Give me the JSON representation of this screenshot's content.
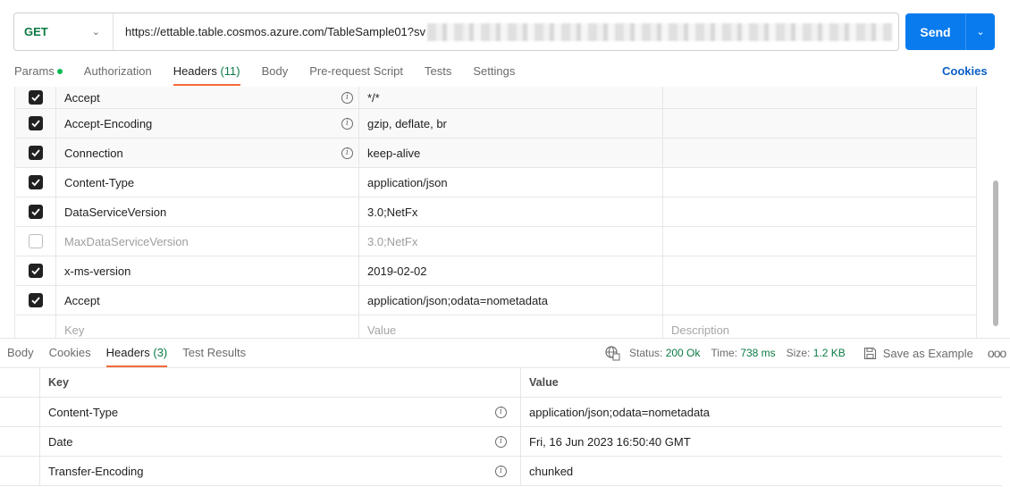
{
  "request": {
    "method": "GET",
    "url": "https://ettable.table.cosmos.azure.com/TableSample01?sv",
    "send_label": "Send"
  },
  "request_tabs": [
    {
      "label": "Params",
      "dot": true
    },
    {
      "label": "Authorization"
    },
    {
      "label": "Headers",
      "count": "(11)",
      "active": true
    },
    {
      "label": "Body"
    },
    {
      "label": "Pre-request Script"
    },
    {
      "label": "Tests"
    },
    {
      "label": "Settings"
    }
  ],
  "cookies_label": "Cookies",
  "request_headers": {
    "rows": [
      {
        "checked": true,
        "key": "Accept",
        "value": "*/*",
        "info": true
      },
      {
        "checked": true,
        "key": "Accept-Encoding",
        "value": "gzip, deflate, br",
        "info": true
      },
      {
        "checked": true,
        "key": "Connection",
        "value": "keep-alive",
        "info": true
      },
      {
        "checked": true,
        "key": "Content-Type",
        "value": "application/json",
        "info": false
      },
      {
        "checked": true,
        "key": "DataServiceVersion",
        "value": "3.0;NetFx",
        "info": false
      },
      {
        "checked": false,
        "key": "MaxDataServiceVersion",
        "value": "3.0;NetFx",
        "info": false
      },
      {
        "checked": true,
        "key": "x-ms-version",
        "value": "2019-02-02",
        "info": false
      },
      {
        "checked": true,
        "key": "Accept",
        "value": "application/json;odata=nometadata",
        "info": false
      }
    ],
    "placeholder": {
      "key": "Key",
      "value": "Value",
      "description": "Description"
    }
  },
  "response_tabs": [
    {
      "label": "Body"
    },
    {
      "label": "Cookies"
    },
    {
      "label": "Headers",
      "count": "(3)",
      "active": true
    },
    {
      "label": "Test Results"
    }
  ],
  "response_meta": {
    "status_label": "Status:",
    "status_value": "200 Ok",
    "time_label": "Time:",
    "time_value": "738 ms",
    "size_label": "Size:",
    "size_value": "1.2 KB",
    "save_label": "Save as Example",
    "more_label": "ooo"
  },
  "response_headers": {
    "columns": {
      "key": "Key",
      "value": "Value"
    },
    "rows": [
      {
        "key": "Content-Type",
        "value": "application/json;odata=nometadata"
      },
      {
        "key": "Date",
        "value": "Fri, 16 Jun 2023 16:50:40 GMT"
      },
      {
        "key": "Transfer-Encoding",
        "value": "chunked"
      }
    ]
  },
  "icons": {
    "method_dropdown": "chevron-down-icon",
    "send_dropdown": "chevron-down-icon",
    "info": "info-icon",
    "network": "globe-icon",
    "save": "save-icon",
    "checkbox": "check-icon"
  },
  "colors": {
    "accent": "#f26b3a",
    "send": "#097bed",
    "method_get": "#0b7a43",
    "link": "#0b5ec7"
  }
}
